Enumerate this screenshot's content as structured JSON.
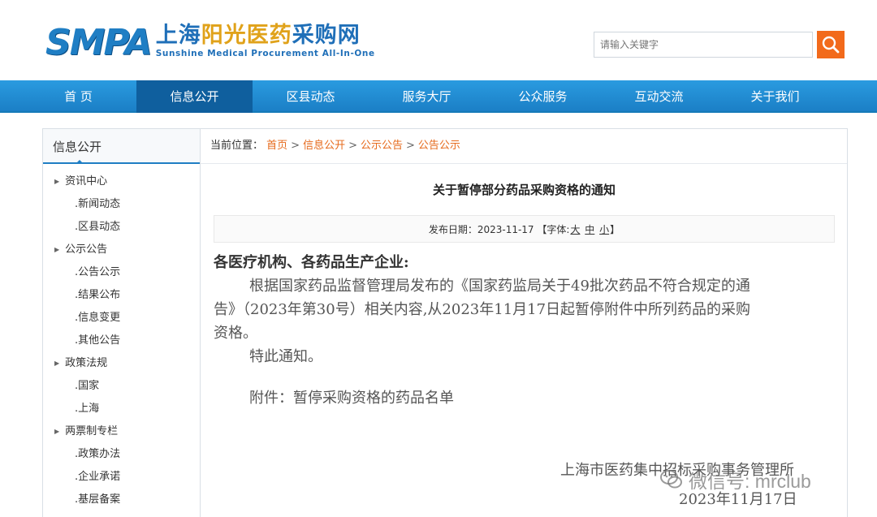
{
  "header": {
    "logo_mark": "SMPA",
    "logo_cn_part1": "上海",
    "logo_cn_part2": "阳光医药",
    "logo_cn_part3": "采购网",
    "logo_en": "Sunshine Medical Procurement All-In-One",
    "search_placeholder": "请输入关键字"
  },
  "nav": {
    "items": [
      "首 页",
      "信息公开",
      "区县动态",
      "服务大厅",
      "公众服务",
      "互动交流",
      "关于我们"
    ],
    "active_index": 1
  },
  "sidebar": {
    "title": "信息公开",
    "groups": [
      {
        "label": "资讯中心",
        "items": [
          ".新闻动态",
          ".区县动态"
        ]
      },
      {
        "label": "公示公告",
        "items": [
          ".公告公示",
          ".结果公布",
          ".信息变更",
          ".其他公告"
        ]
      },
      {
        "label": "政策法规",
        "items": [
          ".国家",
          ".上海"
        ]
      },
      {
        "label": "两票制专栏",
        "items": [
          ".政策办法",
          ".企业承诺",
          ".基层备案"
        ]
      }
    ]
  },
  "breadcrumb": {
    "prefix": "当前位置：",
    "links": [
      "首页",
      "信息公开",
      "公示公告",
      "公告公示"
    ],
    "separator": ">"
  },
  "article": {
    "title": "关于暂停部分药品采购资格的通知",
    "meta_prefix": "发布日期：2023-11-17 【字体:",
    "font_large": "大",
    "font_medium": "中",
    "font_small": "小",
    "meta_suffix": "】",
    "greeting": "各医疗机构、各药品生产企业:",
    "body_line1": "根据国家药品监督管理局发布的《国家药监局关于49批次药品不符合规定的通",
    "body_line2": "告》（2023年第30号）相关内容,从2023年11月17日起暂停附件中所列药品的采购",
    "body_line3": "资格。",
    "closing": "特此通知。",
    "attachment": "附件：暂停采购资格的药品名单",
    "sign_org": "上海市医药集中招标采购事务管理所",
    "sign_date": "2023年11月17日"
  },
  "watermark": {
    "text": "微信号: mrclub"
  },
  "colors": {
    "brand_blue": "#1f7ec4",
    "nav_active": "#0f5f9e",
    "accent_orange": "#f26a1b",
    "link_orange": "#e66a1c"
  }
}
